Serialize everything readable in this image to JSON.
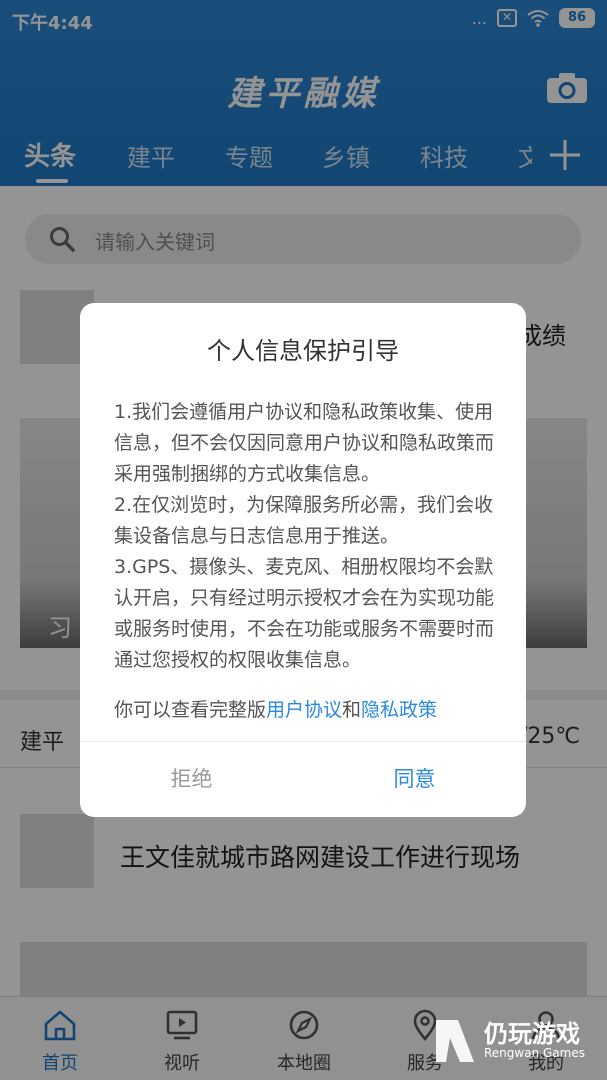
{
  "status_bar": {
    "time": "下午4:44",
    "dots": "...",
    "battery": "86"
  },
  "header": {
    "app_title": "建平融媒",
    "tabs": [
      "头条",
      "建平",
      "专题",
      "乡镇",
      "科技",
      "文"
    ],
    "active_tab_index": 0,
    "add_tab_icon": "plus-icon",
    "camera_icon": "camera-icon"
  },
  "search": {
    "placeholder": "请输入关键词"
  },
  "feed": {
    "item1_title_partial": "成绩",
    "banner_caption_partial": "习",
    "weather_location": "建平",
    "weather_temp_partial": "/25℃",
    "item2_title": "王文佳就城市路网建设工作进行现场"
  },
  "bottom_nav": {
    "items": [
      {
        "label": "首页",
        "icon": "home-icon"
      },
      {
        "label": "视听",
        "icon": "tv-icon"
      },
      {
        "label": "本地圈",
        "icon": "compass-icon"
      },
      {
        "label": "服务",
        "icon": "location-icon"
      },
      {
        "label": "我的",
        "icon": "user-icon"
      }
    ],
    "active_index": 0
  },
  "watermark": {
    "title": "仍玩游戏",
    "subtitle": "Rengwan Games"
  },
  "dialog": {
    "title": "个人信息保护引导",
    "paragraphs": [
      "1.我们会遵循用户协议和隐私政策收集、使用信息，但不会仅因同意用户协议和隐私政策而采用强制捆绑的方式收集信息。",
      "2.在仅浏览时，为保障服务所必需，我们会收集设备信息与日志信息用于推送。",
      "3.GPS、摄像头、麦克风、相册权限均不会默认开启，只有经过明示授权才会在为实现功能或服务时使用，不会在功能或服务不需要时而通过您授权的权限收集信息。"
    ],
    "links_prefix": "你可以查看完整版",
    "link_user_agreement": "用户协议",
    "links_conjunction": "和",
    "link_privacy_policy": "隐私政策",
    "reject_label": "拒绝",
    "agree_label": "同意"
  },
  "colors": {
    "header_blue": "#1f78c6",
    "link_blue": "#2a8ae0"
  }
}
